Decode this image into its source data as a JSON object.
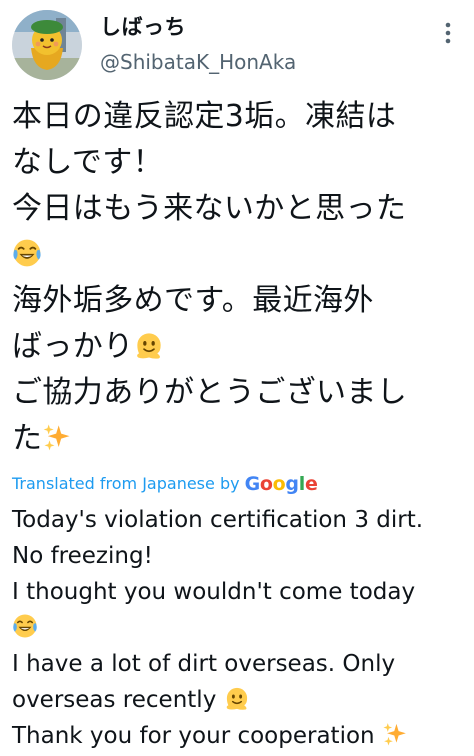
{
  "tweet": {
    "display_name": "しばっち",
    "handle": "@ShibataK_HonAka",
    "original_lines": [
      {
        "text": "本日の違反認定3垢。凍結は",
        "emoji": ""
      },
      {
        "text": "なしです！",
        "emoji": ""
      },
      {
        "text": "今日はもう来ないかと思った",
        "emoji": ""
      },
      {
        "text": "",
        "emoji": "face-with-tears-of-joy"
      },
      {
        "text": "海外垢多めです。最近海外",
        "emoji": ""
      },
      {
        "text": "ばっかり",
        "emoji": "melting-face"
      },
      {
        "text": "ご協力ありがとうございまし",
        "emoji": ""
      },
      {
        "text": "た",
        "emoji": "sparkles"
      }
    ],
    "translated_label": "Translated from Japanese by",
    "google_letters": [
      "G",
      "o",
      "o",
      "g",
      "l",
      "e"
    ],
    "translation_lines": [
      {
        "text": "Today's violation certification 3 dirt.",
        "emoji": ""
      },
      {
        "text": "No freezing!",
        "emoji": ""
      },
      {
        "text": "I thought you wouldn't come today",
        "emoji": ""
      },
      {
        "text": "",
        "emoji": "face-with-tears-of-joy"
      },
      {
        "text": "I have a lot of dirt overseas. Only",
        "emoji": ""
      },
      {
        "text": "overseas recently ",
        "emoji": "melting-face"
      },
      {
        "text": "Thank you for your cooperation ",
        "emoji": "sparkles"
      }
    ]
  },
  "colors": {
    "text_primary": "#0f1419",
    "text_secondary": "#536471",
    "link_blue": "#1d9bf0"
  }
}
